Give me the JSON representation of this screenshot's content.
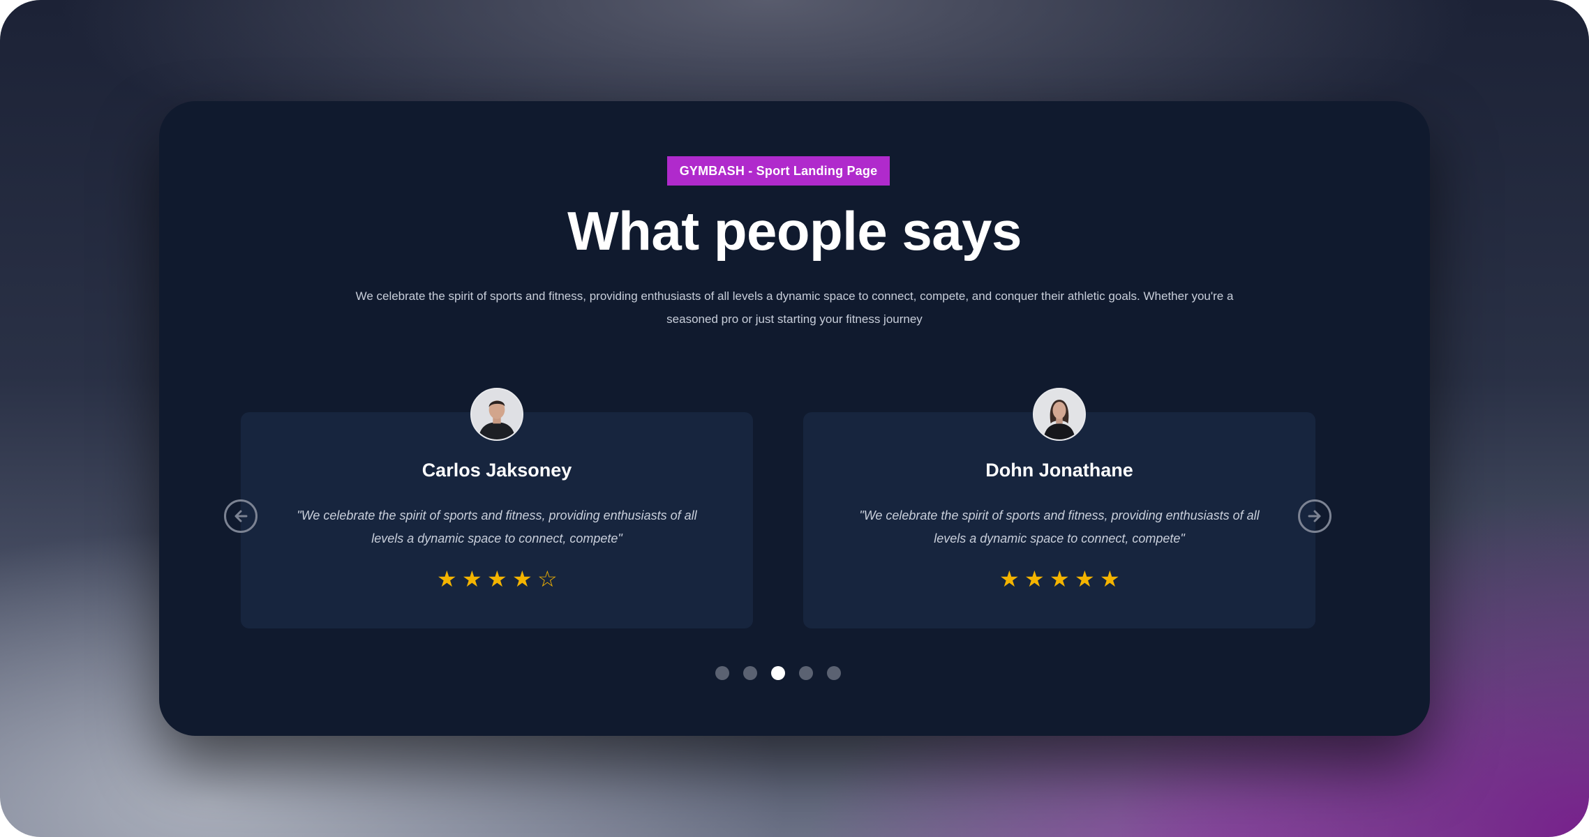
{
  "colors": {
    "card_background": "#101a2e",
    "testimonial_background": "#17253e",
    "badge": "#b02acc",
    "star": "#f4b400",
    "dot_active": "#ffffff",
    "dot_inactive": "#5b6272"
  },
  "header": {
    "badge": "GYMBASH - Sport Landing Page",
    "title": "What people says",
    "subtitle": "We celebrate the spirit of sports and fitness, providing enthusiasts of all levels a dynamic space to connect, compete, and conquer their athletic goals. Whether you're a seasoned pro or just starting your fitness journey"
  },
  "carousel": {
    "prev_icon": "arrow-left-icon",
    "next_icon": "arrow-right-icon",
    "active_slide": 3,
    "slide_count": 5,
    "testimonials": [
      {
        "name": "Carlos Jaksoney",
        "quote": "\"We celebrate the spirit of sports and fitness, providing enthusiasts of all levels a dynamic space to connect, compete\"",
        "rating": 4,
        "max_rating": 5,
        "avatar_icon": "avatar-male"
      },
      {
        "name": "Dohn Jonathane",
        "quote": "\"We celebrate the spirit of sports and fitness, providing enthusiasts of all levels a dynamic space to connect, compete\"",
        "rating": 5,
        "max_rating": 5,
        "avatar_icon": "avatar-female"
      }
    ]
  }
}
